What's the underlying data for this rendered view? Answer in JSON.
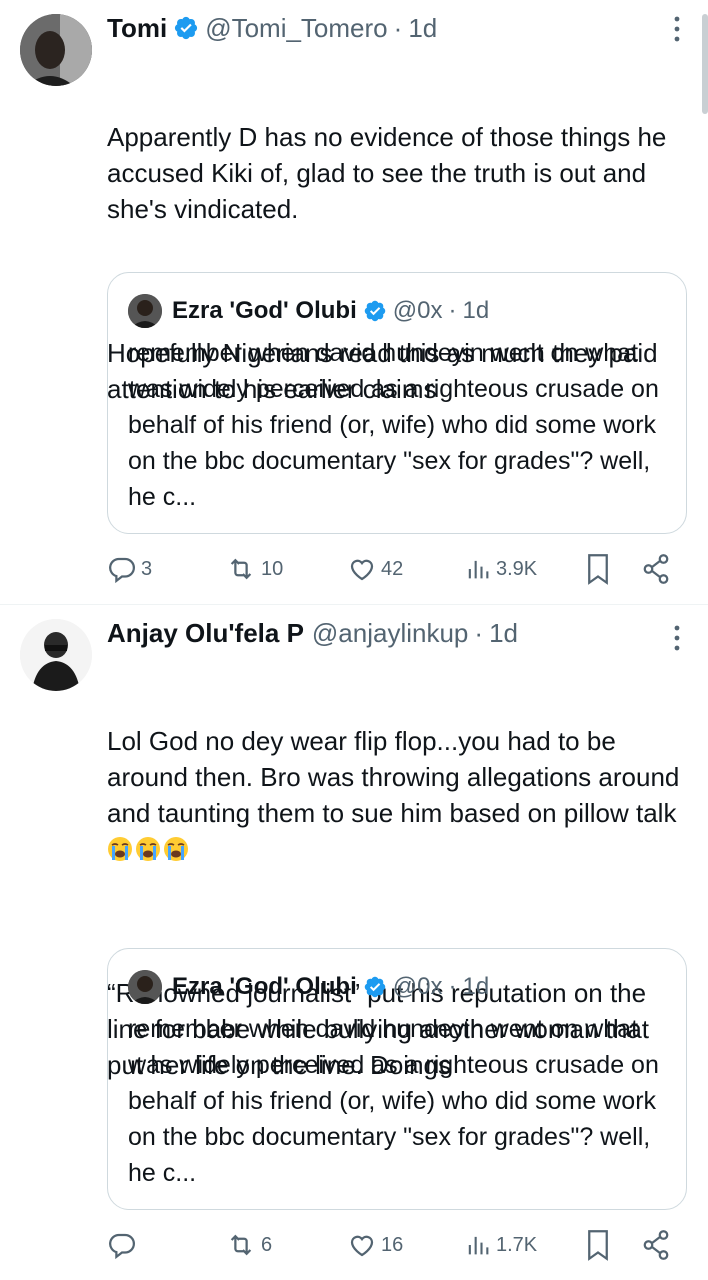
{
  "tweets": [
    {
      "name": "Tomi",
      "handle": "@Tomi_Tomero",
      "dot": "·",
      "time": "1d",
      "text_p1": "Apparently D has no evidence of those things he accused Kiki of, glad to see the truth is out and she's vindicated.",
      "text_p2": "Hopefully Nigerians read this as much they paid attention to his earlier claims",
      "quote": {
        "name": "Ezra 'God' Olubi",
        "handle": "@0x",
        "dot": "·",
        "time": "1d",
        "text": "remember when david hundeyin went on what was widely perceived as a righteous crusade on behalf of his friend (or, wife) who did some work on the bbc documentary \"sex for grades\"? well, he c..."
      },
      "actions": {
        "replies": "3",
        "retweets": "10",
        "likes": "42",
        "views": "3.9K"
      }
    },
    {
      "name": "Anjay Olu'fela P",
      "handle": "@anjaylinkup",
      "dot": "·",
      "time": "1d",
      "text_p1": "Lol God no dey wear flip flop...you had to be around then. Bro was throwing allegations around and taunting them to sue him based on pillow talk",
      "text_p2": "“Renowned journalist” put his reputation on the line for babe while bullying another woman that put her life on the line. Doings",
      "quote": {
        "name": "Ezra 'God' Olubi",
        "handle": "@0x",
        "dot": "·",
        "time": "1d",
        "text": "remember when david hundeyin went on what was widely perceived as a righteous crusade on behalf of his friend (or, wife) who did some work on the bbc documentary \"sex for grades\"? well, he c..."
      },
      "actions": {
        "replies": "",
        "retweets": "6",
        "likes": "16",
        "views": "1.7K"
      }
    }
  ],
  "icons": {
    "verified": "verified-badge-icon",
    "more": "more-options-icon",
    "reply": "reply-icon",
    "retweet": "retweet-icon",
    "like": "heart-icon",
    "views": "views-icon",
    "bookmark": "bookmark-icon",
    "share": "share-icon",
    "emoji": "loudly-crying-face-emoji"
  },
  "colors": {
    "verified": "#1d9bf0",
    "secondary_text": "#536471",
    "border": "#cfd9de"
  }
}
